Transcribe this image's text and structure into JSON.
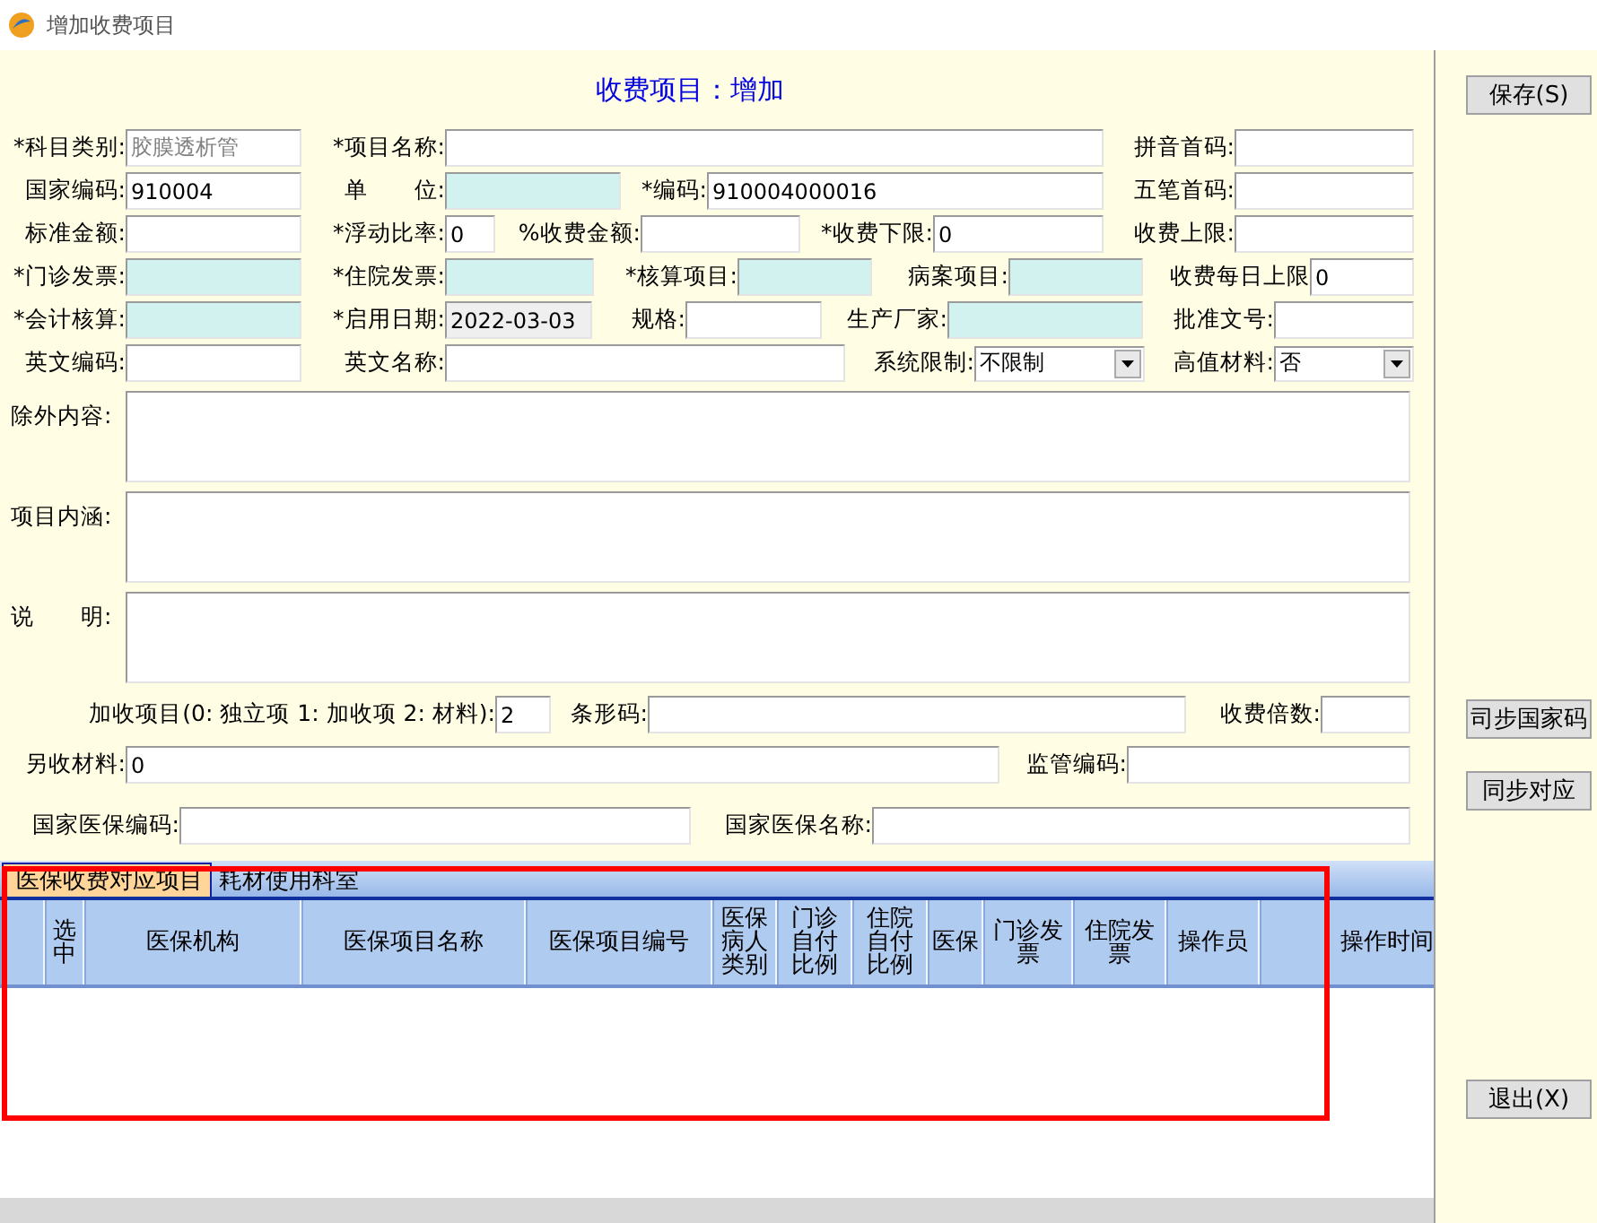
{
  "window": {
    "title": "增加收费项目"
  },
  "header": "收费项目：增加",
  "form_rows": [
    [
      {
        "label": "*科目类别:",
        "kind": "locked",
        "value": "胶膜透析管"
      },
      {
        "label": "*项目名称:",
        "kind": "text"
      },
      {
        "label": "拼音首码:",
        "kind": "text"
      }
    ],
    [
      {
        "label": "国家编码:",
        "kind": "text",
        "value": "910004"
      },
      {
        "label": "单　　位:",
        "kind": "lookup"
      },
      {
        "label": "*编码:",
        "kind": "text",
        "value": "910004000016"
      },
      {
        "label": "五笔首码:",
        "kind": "text"
      }
    ],
    [
      {
        "label": "标准金额:",
        "kind": "text"
      },
      {
        "label": "*浮动比率:",
        "kind": "text",
        "value": "0"
      },
      {
        "label": "%收费金额:",
        "kind": "text"
      },
      {
        "label": "*收费下限:",
        "kind": "text",
        "value": "0"
      },
      {
        "label": "收费上限:",
        "kind": "text"
      }
    ],
    [
      {
        "label": "*门诊发票:",
        "kind": "lookup"
      },
      {
        "label": "*住院发票:",
        "kind": "lookup"
      },
      {
        "label": "*核算项目:",
        "kind": "lookup"
      },
      {
        "label": "病案项目:",
        "kind": "lookup"
      },
      {
        "label": "收费每日上限",
        "kind": "text",
        "value": "0"
      }
    ],
    [
      {
        "label": "*会计核算:",
        "kind": "lookup"
      },
      {
        "label": "*启用日期:",
        "kind": "readonly",
        "value": "2022-03-03"
      },
      {
        "label": "规格:",
        "kind": "text"
      },
      {
        "label": "生产厂家:",
        "kind": "lookup"
      },
      {
        "label": "批准文号:",
        "kind": "text"
      }
    ],
    [
      {
        "label": "英文编码:",
        "kind": "text"
      },
      {
        "label": "英文名称:",
        "kind": "text"
      },
      {
        "label": "系统限制:",
        "kind": "dropdown",
        "value": "不限制"
      },
      {
        "label": "高值材料:",
        "kind": "dropdown",
        "value": "否"
      }
    ]
  ],
  "text_areas": [
    {
      "label": "除外内容:"
    },
    {
      "label": "项目内涵:"
    },
    {
      "label": "说　　明:"
    }
  ],
  "lower_rows": [
    [
      {
        "label": "加收项目(0: 独立项 1: 加收项 2: 材料):",
        "kind": "text",
        "value": "2"
      },
      {
        "label": "条形码:",
        "kind": "text"
      },
      {
        "label": "收费倍数:",
        "kind": "text"
      }
    ],
    [
      {
        "label": "另收材料:",
        "kind": "text",
        "value": "0"
      },
      {
        "label": "监管编码:",
        "kind": "text"
      }
    ],
    [
      {
        "label": "国家医保编码:",
        "kind": "text"
      },
      {
        "label": "国家医保名称:",
        "kind": "text"
      }
    ]
  ],
  "tabs": [
    {
      "label": "医保收费对应项目",
      "selected": true
    },
    {
      "label": "耗材使用科室",
      "selected": false
    }
  ],
  "table": {
    "columns": [
      "选中",
      "医保机构",
      "医保项目名称",
      "医保项目编号",
      "医保病人类别",
      "门诊自付比例",
      "住院自付比例",
      "医保",
      "门诊发票",
      "住院发票",
      "操作员",
      "操作时间"
    ]
  },
  "side_buttons": [
    {
      "label": "保存(S)"
    },
    {
      "label": "司步国家码"
    },
    {
      "label": "同步对应"
    },
    {
      "label": "退出(X)"
    }
  ]
}
